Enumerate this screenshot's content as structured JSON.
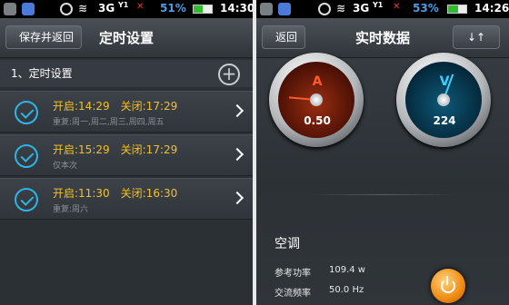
{
  "left": {
    "status": {
      "network": "3G",
      "signal_tag": "Y1",
      "battery_pct": "51%",
      "time": "14:30",
      "battery_fill": 0.51
    },
    "header": {
      "back_label": "保存并返回",
      "title": "定时设置"
    },
    "section": {
      "title": "1、定时设置",
      "add_icon": "plus-circle-icon"
    },
    "schedules": [
      {
        "open": "开启:14:29",
        "close": "关闭:17:29",
        "repeat": "重复:周一,周二,周三,周四,周五"
      },
      {
        "open": "开启:15:29",
        "close": "关闭:17:29",
        "repeat": "仅本次"
      },
      {
        "open": "开启:11:30",
        "close": "关闭:16:30",
        "repeat": "重复:周六"
      }
    ]
  },
  "right": {
    "status": {
      "network": "3G",
      "signal_tag": "Y1",
      "battery_pct": "53%",
      "time": "14:26",
      "battery_fill": 0.53
    },
    "header": {
      "back_label": "返回",
      "title": "实时数据",
      "refresh_icon": "swap-arrows-icon"
    },
    "gauges": [
      {
        "letter": "A",
        "value": "0.50",
        "color": "#ff5a2a"
      },
      {
        "letter": "V",
        "value": "224",
        "color": "#3fd0ff"
      }
    ],
    "device": {
      "name": "空调"
    },
    "stats": [
      {
        "label": "参考功率",
        "value": "109.4 w"
      },
      {
        "label": "交流频率",
        "value": "50.0 Hz"
      }
    ]
  }
}
